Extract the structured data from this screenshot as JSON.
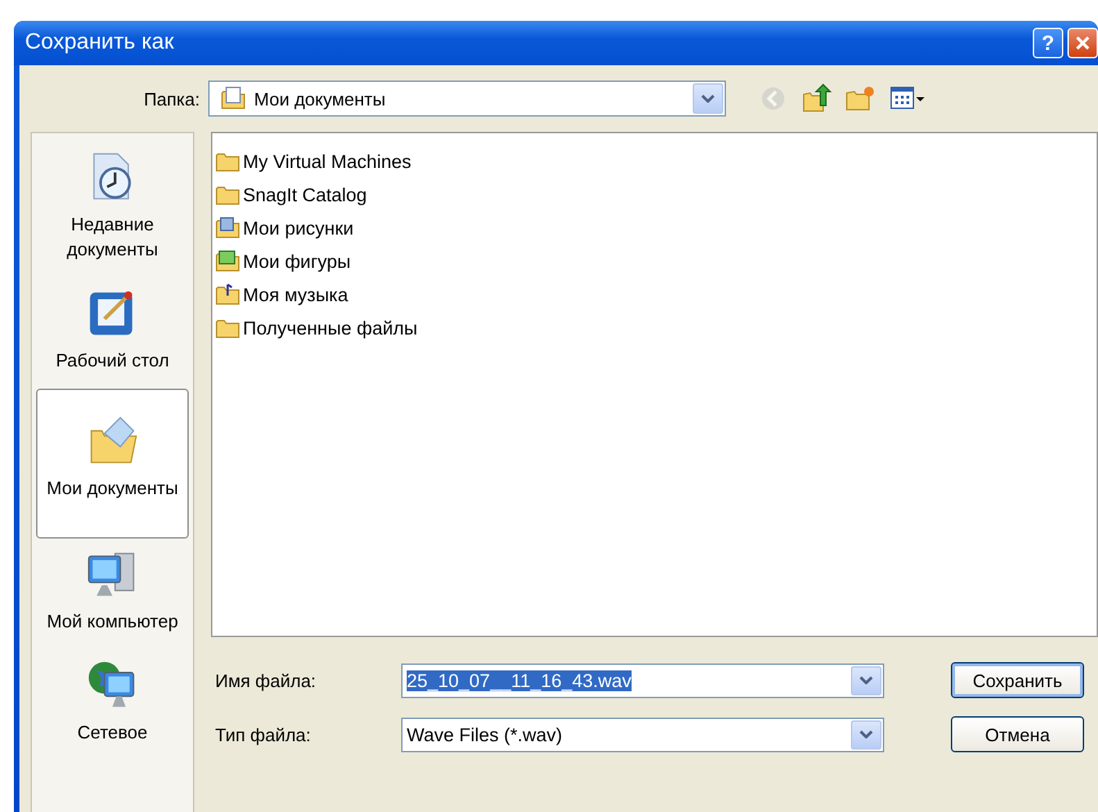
{
  "window": {
    "title": "Сохранить как"
  },
  "title_buttons": [
    {
      "kind": "help",
      "label": "?"
    },
    {
      "kind": "close"
    }
  ],
  "folder": {
    "label": "Папка:",
    "value": "Мои документы"
  },
  "toolbar": [
    {
      "kind": "back",
      "disabled": true
    },
    {
      "kind": "up",
      "disabled": false
    },
    {
      "kind": "new-folder",
      "disabled": false
    },
    {
      "kind": "views",
      "disabled": false
    }
  ],
  "places": [
    {
      "kind": "recent",
      "label": "Недавние документы",
      "selected": false
    },
    {
      "kind": "desktop",
      "label": "Рабочий стол",
      "selected": false
    },
    {
      "kind": "documents",
      "label": "Мои документы",
      "selected": true
    },
    {
      "kind": "computer",
      "label": "Мой компьютер",
      "selected": false
    },
    {
      "kind": "network",
      "label": "Сетевое",
      "selected": false
    }
  ],
  "files": [
    {
      "kind": "folder",
      "name": "My Virtual Machines"
    },
    {
      "kind": "folder",
      "name": "SnagIt Catalog"
    },
    {
      "kind": "pictures",
      "name": "Мои рисунки"
    },
    {
      "kind": "shapes",
      "name": "Мои фигуры"
    },
    {
      "kind": "music",
      "name": "Моя музыка"
    },
    {
      "kind": "folder",
      "name": "Полученные файлы"
    }
  ],
  "file_name": {
    "label": "Имя файла:",
    "value": "25_10_07__11_16_43.wav",
    "selected": true
  },
  "file_type": {
    "label": "Тип файла:",
    "value": "Wave Files (*.wav)"
  },
  "buttons": [
    {
      "kind": "default",
      "label": "Сохранить"
    },
    {
      "kind": "normal",
      "label": "Отмена"
    }
  ]
}
